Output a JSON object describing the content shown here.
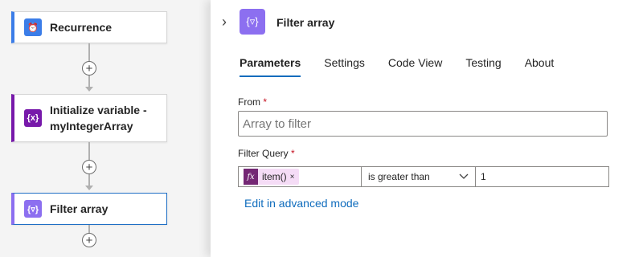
{
  "canvas": {
    "cards": [
      {
        "label": "Recurrence",
        "icon": "alarm-clock-icon",
        "icon_glyph": "⏰",
        "accent": "#3b7de8"
      },
      {
        "label": "Initialize variable - myIntegerArray",
        "icon": "variable-icon",
        "icon_glyph": "{x}",
        "accent": "#7719aa"
      },
      {
        "label": "Filter array",
        "icon": "filter-array-icon",
        "icon_glyph": "{▿}",
        "accent": "#8c6ff0"
      }
    ],
    "add_symbol": "+"
  },
  "panel": {
    "collapse_glyph": "›",
    "icon_glyph": "{▿}",
    "title": "Filter array",
    "tabs": [
      {
        "label": "Parameters",
        "active": true
      },
      {
        "label": "Settings",
        "active": false
      },
      {
        "label": "Code View",
        "active": false
      },
      {
        "label": "Testing",
        "active": false
      },
      {
        "label": "About",
        "active": false
      }
    ],
    "from": {
      "label": "From",
      "required_mark": "*",
      "value": "",
      "placeholder": "Array to filter"
    },
    "filter_query": {
      "label": "Filter Query",
      "required_mark": "*",
      "token_fx": "fx",
      "token_text": "item()",
      "token_remove": "×",
      "operator": "is greater than",
      "value": "1"
    },
    "advanced_link": "Edit in advanced mode"
  }
}
